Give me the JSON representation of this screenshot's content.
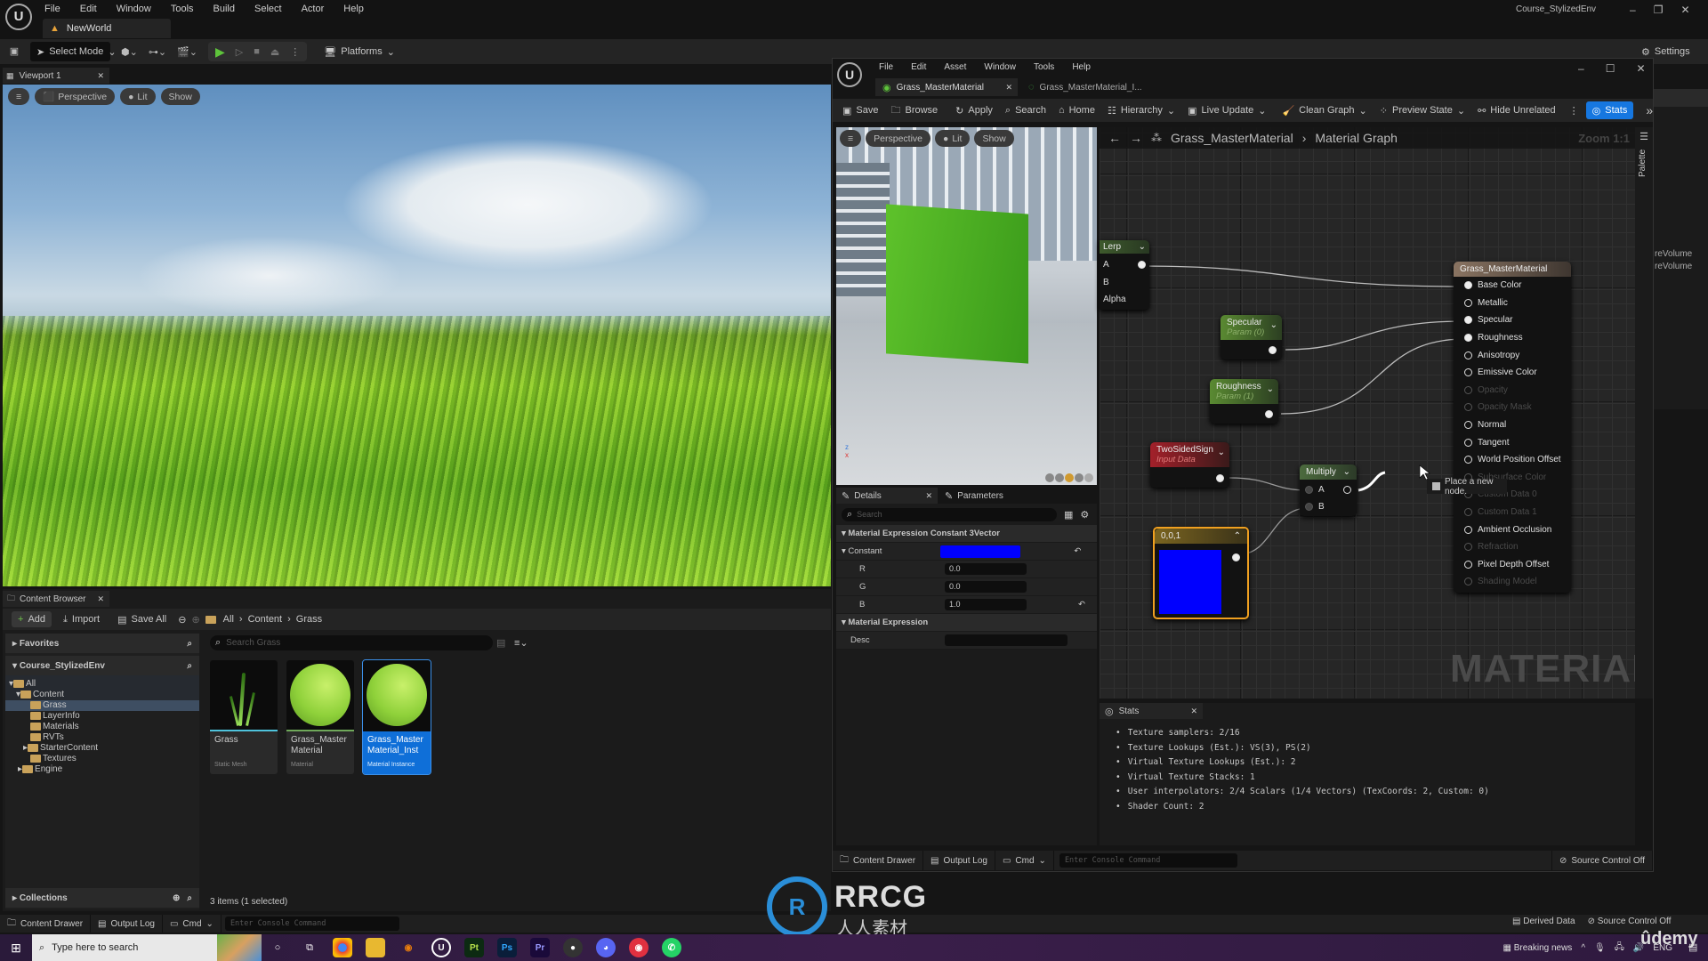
{
  "main_editor": {
    "menu": [
      "File",
      "Edit",
      "Window",
      "Tools",
      "Build",
      "Select",
      "Actor",
      "Help"
    ],
    "level_tab": "NewWorld",
    "project_name": "Course_StylizedEnv",
    "toolbar": {
      "select_mode": "Select Mode",
      "platforms": "Platforms",
      "settings": "Settings"
    },
    "viewport": {
      "tab": "Viewport 1",
      "perspective": "Perspective",
      "lit": "Lit",
      "show": "Show"
    },
    "outliner_partial": [
      "reVolume",
      "reVolume"
    ]
  },
  "content_browser": {
    "tab": "Content Browser",
    "add": "Add",
    "import": "Import",
    "save_all": "Save All",
    "breadcrumb": [
      "All",
      "Content",
      "Grass"
    ],
    "favorites": "Favorites",
    "project": "Course_StylizedEnv",
    "tree": [
      "All",
      "Content",
      "Grass",
      "LayerInfo",
      "Materials",
      "RVTs",
      "StarterContent",
      "Textures",
      "Engine"
    ],
    "search_placeholder": "Search Grass",
    "assets": [
      {
        "name": "Grass",
        "type": "Static Mesh",
        "selected": false
      },
      {
        "name": "Grass_Master Material",
        "type": "Material",
        "selected": false
      },
      {
        "name": "Grass_Master Material_Inst",
        "type": "Material Instance",
        "selected": true
      }
    ],
    "collections": "Collections",
    "status": "3 items (1 selected)"
  },
  "status_bar": {
    "content_drawer": "Content Drawer",
    "output_log": "Output Log",
    "cmd": "Cmd",
    "console_placeholder": "Enter Console Command",
    "derived_data": "Derived Data",
    "source_control": "Source Control Off"
  },
  "material_editor": {
    "menu": [
      "File",
      "Edit",
      "Asset",
      "Window",
      "Tools",
      "Help"
    ],
    "tabs": [
      "Grass_MasterMaterial",
      "Grass_MasterMaterial_I..."
    ],
    "toolbar": [
      "Save",
      "Browse",
      "Apply",
      "Search",
      "Home",
      "Hierarchy",
      "Live Update",
      "Clean Graph",
      "Preview State",
      "Hide Unrelated"
    ],
    "stats_button": "Stats",
    "preview": {
      "perspective": "Perspective",
      "lit": "Lit",
      "show": "Show"
    },
    "graph": {
      "breadcrumb": [
        "Grass_MasterMaterial",
        "Material Graph"
      ],
      "zoom": "Zoom 1:1",
      "palette": "Palette",
      "watermark": "MATERIAL",
      "tooltip": "Place a new node.",
      "lerp": {
        "title": "Lerp",
        "pins": [
          "A",
          "B",
          "Alpha"
        ]
      },
      "specular": {
        "title": "Specular",
        "sub": "Param (0)"
      },
      "roughness": {
        "title": "Roughness",
        "sub": "Param (1)"
      },
      "twosided": {
        "title": "TwoSidedSign",
        "sub": "Input Data"
      },
      "multiply": {
        "title": "Multiply",
        "pins": [
          "A",
          "B"
        ]
      },
      "constant": {
        "title": "0,0,1",
        "color": "#0000ff"
      },
      "result": {
        "title": "Grass_MasterMaterial",
        "pins": [
          {
            "label": "Base Color",
            "state": "connected"
          },
          {
            "label": "Metallic",
            "state": "open"
          },
          {
            "label": "Specular",
            "state": "connected"
          },
          {
            "label": "Roughness",
            "state": "connected"
          },
          {
            "label": "Anisotropy",
            "state": "open"
          },
          {
            "label": "Emissive Color",
            "state": "open"
          },
          {
            "label": "Opacity",
            "state": "disabled"
          },
          {
            "label": "Opacity Mask",
            "state": "disabled"
          },
          {
            "label": "Normal",
            "state": "open"
          },
          {
            "label": "Tangent",
            "state": "open"
          },
          {
            "label": "World Position Offset",
            "state": "open"
          },
          {
            "label": "Subsurface Color",
            "state": "disabled"
          },
          {
            "label": "Custom Data 0",
            "state": "disabled"
          },
          {
            "label": "Custom Data 1",
            "state": "disabled"
          },
          {
            "label": "Ambient Occlusion",
            "state": "open"
          },
          {
            "label": "Refraction",
            "state": "disabled"
          },
          {
            "label": "Pixel Depth Offset",
            "state": "open"
          },
          {
            "label": "Shading Model",
            "state": "disabled"
          }
        ]
      }
    },
    "details": {
      "tab": "Details",
      "params_tab": "Parameters",
      "search_placeholder": "Search",
      "section1": "Material Expression Constant 3Vector",
      "constant_label": "Constant",
      "constant_color": "#0000ff",
      "r_label": "R",
      "r": "0.0",
      "g_label": "G",
      "g": "0.0",
      "b_label": "B",
      "b": "1.0",
      "section2": "Material Expression",
      "desc_label": "Desc"
    },
    "stats": {
      "tab": "Stats",
      "lines": [
        "Texture samplers: 2/16",
        "Texture Lookups (Est.): VS(3), PS(2)",
        "Virtual Texture Lookups (Est.): 2",
        "Virtual Texture Stacks: 1",
        "User interpolators: 2/4 Scalars (1/4 Vectors) (TexCoords: 2, Custom: 0)",
        "Shader Count: 2"
      ]
    }
  },
  "taskbar": {
    "search_placeholder": "Type here to search",
    "news": "Breaking news",
    "lang": "ENG",
    "apps": [
      "Pt",
      "Ps",
      "Pr"
    ]
  },
  "watermarks": {
    "rrcg": "RRCG",
    "rrcg_cn": "人人素材",
    "udemy": "ûdemy"
  }
}
